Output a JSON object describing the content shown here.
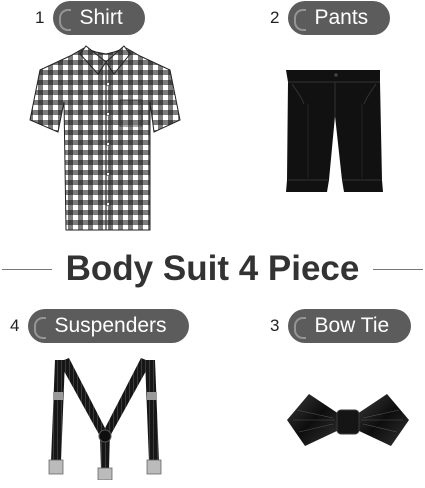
{
  "items": [
    {
      "number": "1",
      "label": "Shirt"
    },
    {
      "number": "2",
      "label": "Pants"
    },
    {
      "number": "4",
      "label": "Suspenders"
    },
    {
      "number": "3",
      "label": "Bow Tie"
    }
  ],
  "title": "Body Suit 4 Piece",
  "colors": {
    "pill": "#5c5c5c",
    "title_text": "#333333",
    "garment": "#111111"
  },
  "icons": [
    "gingham-shirt-image",
    "black-shorts-image",
    "suspenders-image",
    "bow-tie-image"
  ]
}
